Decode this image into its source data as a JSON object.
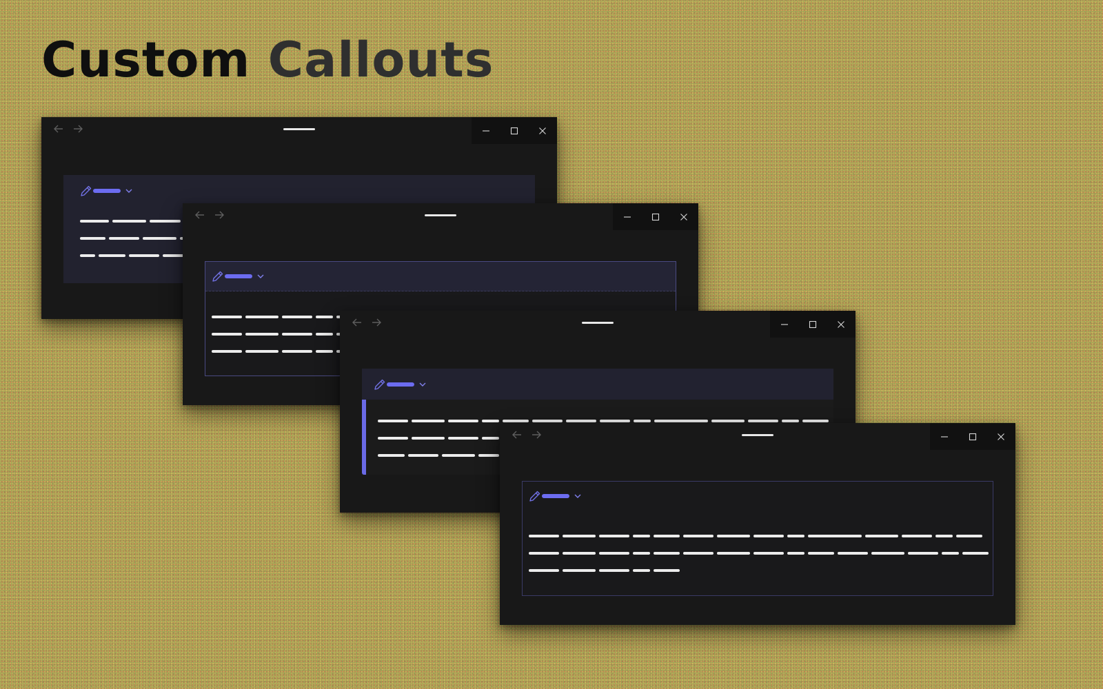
{
  "heading": {
    "part1": "Custom",
    "part2": "Callouts"
  },
  "icons": {
    "back": "arrow-left-icon",
    "forward": "arrow-right-icon",
    "minimize": "minimize-icon",
    "maximize": "maximize-icon",
    "close": "close-icon",
    "callout": "pencil-icon",
    "collapse": "chevron-down-icon"
  },
  "colors": {
    "accent": "#6c6cf0",
    "window_bg": "#181818",
    "callout_bg": "#22222f",
    "callout_border": "#4a4a82",
    "text_line": "#ececec"
  }
}
